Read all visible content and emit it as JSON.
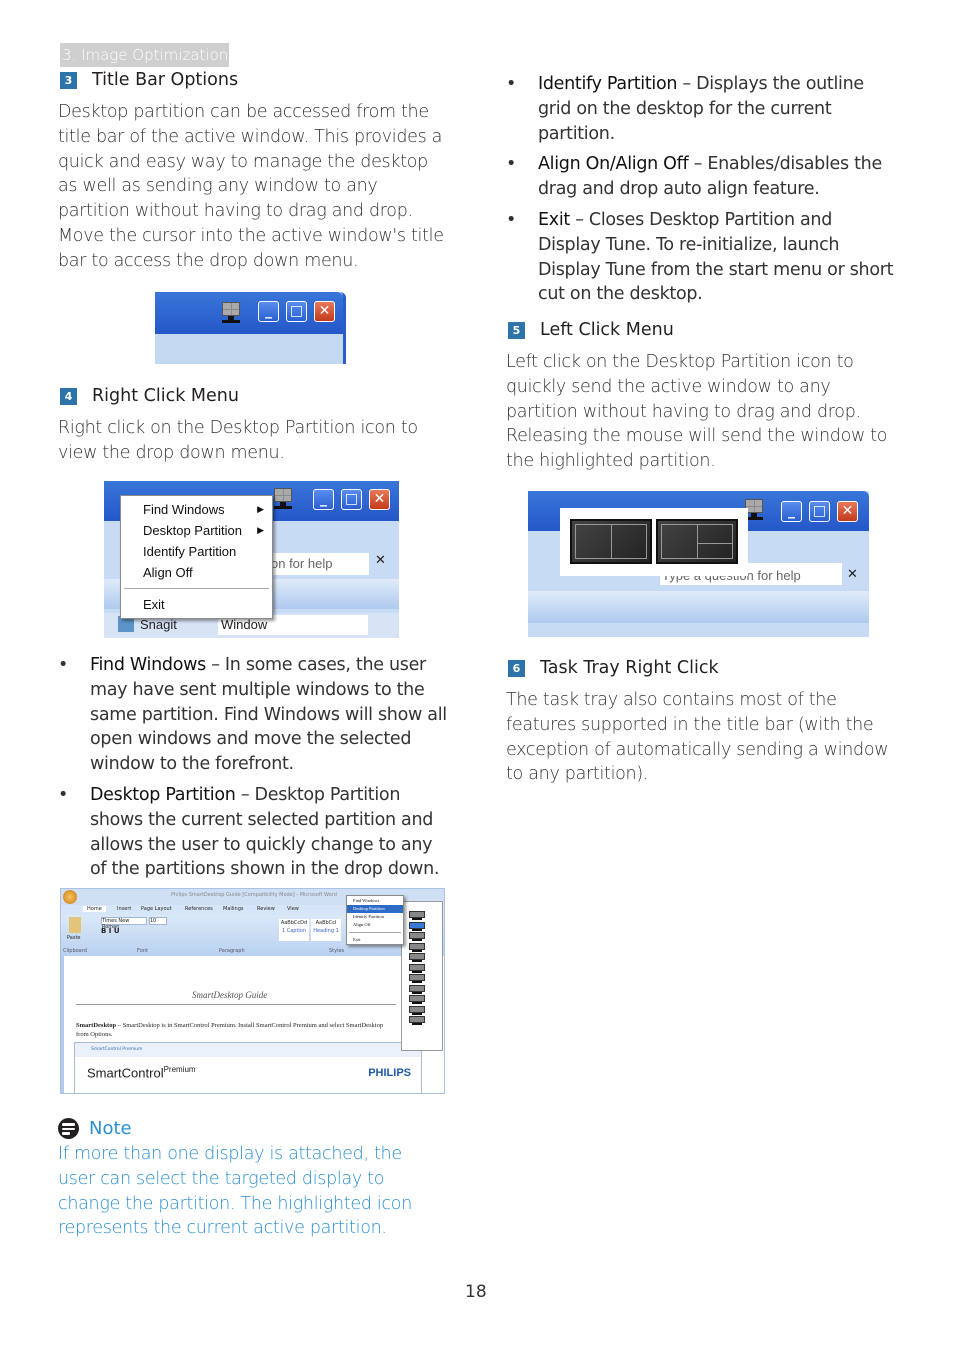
{
  "header": {
    "section": "3. Image Optimization"
  },
  "left": {
    "s3": {
      "num": "3",
      "title": "Title Bar Options",
      "body": "Desktop partition can be accessed from the title bar of the active window. This provides a quick and easy way to manage the desktop as well as sending any window to any partition without having to drag and drop.  Move the cursor into the active window's title bar to access the drop down menu."
    },
    "s4": {
      "num": "4",
      "title": "Right Click Menu",
      "body": "Right click on the Desktop Partition icon to view the drop down menu."
    },
    "bullets": [
      {
        "term": "Find Windows",
        "desc": " – In some cases, the user may have sent multiple windows to the same partition.  Find Windows will show all open windows and move the selected window to the forefront."
      },
      {
        "term": "Desktop Partition",
        "desc": " – Desktop Partition shows the current selected partition and allows the user to quickly change to any of the partitions shown in the drop down."
      }
    ],
    "note": {
      "title": "Note",
      "body": "If more than one display is attached, the user can select the targeted display to change the partition. The highlighted icon represents the current active partition."
    }
  },
  "right": {
    "bullets": [
      {
        "term": "Identify Partition",
        "desc": " – Displays the outline grid on the desktop for the current partition."
      },
      {
        "term": "Align On/Align Off",
        "desc": " – Enables/disables the drag and drop auto align feature."
      },
      {
        "term": "Exit",
        "desc": " – Closes Desktop Partition and Display Tune.  To re-initialize, launch Display Tune from the start menu or short cut on the desktop."
      }
    ],
    "s5": {
      "num": "5",
      "title": "Left Click Menu",
      "body": "Left click on the Desktop Partition icon to quickly send the active window to any partition without having to drag and drop. Releasing the mouse will send the window to the highlighted partition."
    },
    "s6": {
      "num": "6",
      "title": "Task Tray Right Click",
      "body": "The task tray also contains most of the features supported in the title bar (with the exception of automatically sending a window to any partition)."
    }
  },
  "screenshots": {
    "title_bar": {
      "buttons": [
        "_",
        "□",
        "✕"
      ]
    },
    "right_click_menu": {
      "items": [
        {
          "label": "Find Windows",
          "submenu": true
        },
        {
          "label": "Desktop Partition",
          "submenu": true
        },
        {
          "label": "Identify Partition",
          "submenu": false
        },
        {
          "label": "Align Off",
          "submenu": false
        }
      ],
      "exit": "Exit",
      "help_text": "on for help",
      "snagit": "Snagit",
      "window": "Window"
    },
    "word": {
      "title": "Philips SmartDesktop Guide [Compatibility Mode] - Microsoft Word",
      "tabs": [
        "Home",
        "Insert",
        "Page Layout",
        "References",
        "Mailings",
        "Review",
        "View"
      ],
      "font": "Times New Roman",
      "font_size": "10",
      "groups": [
        "Clipboard",
        "Font",
        "Paragraph",
        "Styles"
      ],
      "paste": "Paste",
      "styles": [
        {
          "sample": "AaBbCcDd",
          "name": "1 Caption"
        },
        {
          "sample": "AaBbCcI",
          "name": "Heading 1"
        }
      ],
      "doc_heading": "SmartDesktop Guide",
      "doc_body_bold": "SmartDesktop",
      "doc_body": " – SmartDesktop is in SmartControl Premium.  Install SmartControl Premium and select SmartDesktop from Options.",
      "menu": [
        "Find Windows",
        "Desktop Partition",
        "Identify Partition",
        "Align Off"
      ],
      "menu_exit": "Exit",
      "smartcontrol_title": "SmartControl Premium",
      "smartcontrol_brand": "SmartControl",
      "smartcontrol_super": "Premium",
      "philips": "PHILIPS"
    },
    "left_click": {
      "help_text": "Type a question for help"
    }
  },
  "footer": {
    "page": "18"
  }
}
